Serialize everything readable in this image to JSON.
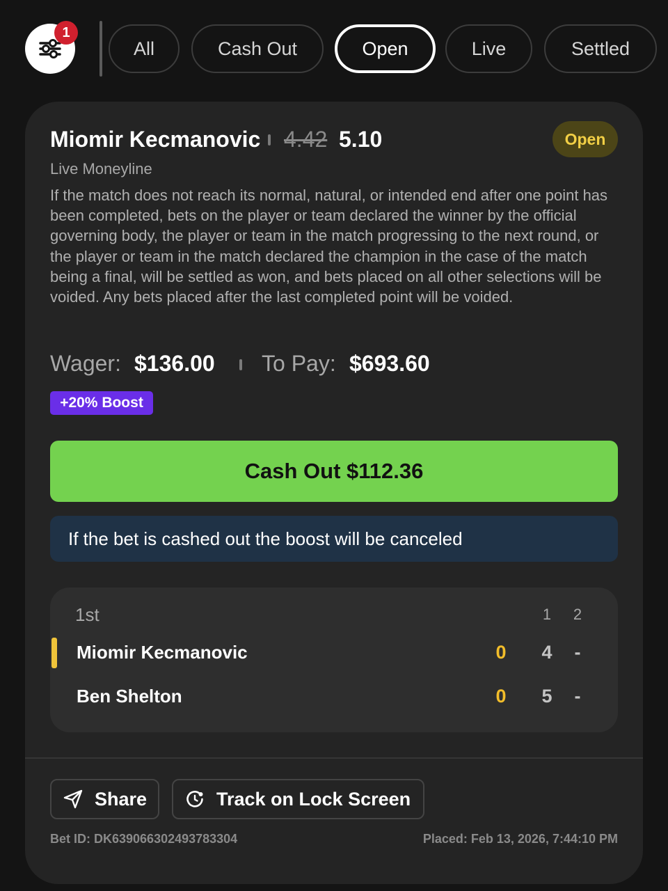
{
  "filters": {
    "badge_count": "1",
    "chips": [
      {
        "label": "All",
        "active": false
      },
      {
        "label": "Cash Out",
        "active": false
      },
      {
        "label": "Open",
        "active": true
      },
      {
        "label": "Live",
        "active": false
      },
      {
        "label": "Settled",
        "active": false
      }
    ]
  },
  "bet": {
    "selection": "Miomir Kecmanovic",
    "original_odds": "4.42",
    "boosted_odds": "5.10",
    "status": "Open",
    "market": "Live Moneyline",
    "rules": "If the match does not reach its normal, natural, or intended end after one point has been completed, bets on the player or team declared the winner by the official governing body, the player or team in the match progressing to the next round, or the player or team in the match declared the champion in the case of the match being a final, will be settled as won, and bets placed on all other selections will be voided. Any bets placed after the last completed point will be voided.",
    "wager_label": "Wager:",
    "wager_value": "$136.00",
    "topay_label": "To Pay:",
    "topay_value": "$693.60",
    "boost_tag": "+20% Boost",
    "cashout_label": "Cash Out $112.36",
    "info_banner": "If the bet is cashed out the boost will be canceled"
  },
  "scoreboard": {
    "period": "1st",
    "set_headers": [
      "1",
      "2"
    ],
    "players": [
      {
        "name": "Miomir Kecmanovic",
        "points": "0",
        "set1": "4",
        "set2": "-",
        "serving": true
      },
      {
        "name": "Ben Shelton",
        "points": "0",
        "set1": "5",
        "set2": "-",
        "serving": false
      }
    ]
  },
  "actions": {
    "share_label": "Share",
    "track_label": "Track on Lock Screen"
  },
  "footer": {
    "bet_id": "Bet ID: DK639066302493783304",
    "placed": "Placed: Feb 13, 2026, 7:44:10 PM"
  },
  "colors": {
    "background": "#141414",
    "card": "#242424",
    "cashout_green": "#74d24f",
    "boost_purple": "#6a2ee8",
    "status_yellow": "#f2cf45",
    "badge_red": "#d0202e"
  }
}
